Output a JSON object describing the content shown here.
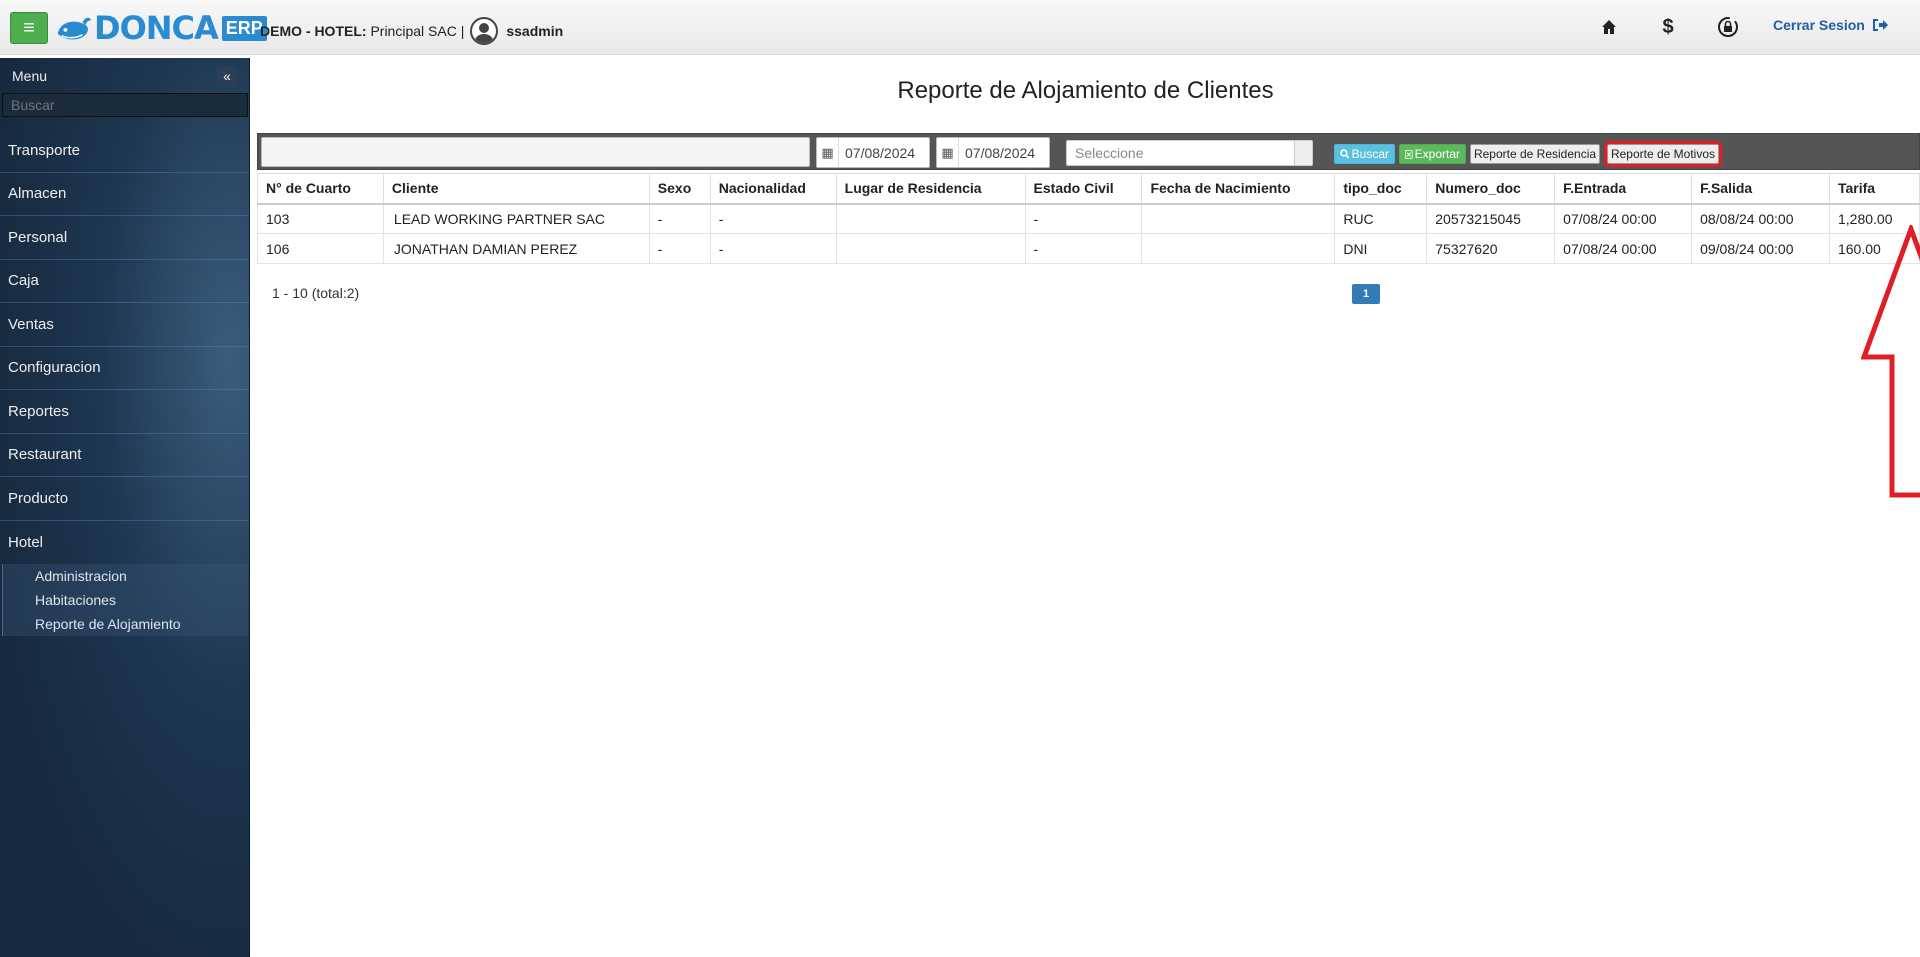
{
  "header": {
    "logo_text": "DONCA",
    "logo_badge": "ERP",
    "company_prefix": "DEMO - HOTEL:",
    "company_name": "Principal SAC |",
    "username": "ssadmin",
    "logout_label": "Cerrar Sesion",
    "icons": [
      "hamburger-icon",
      "home-icon",
      "dollar-icon",
      "lock-icon",
      "logout-icon"
    ]
  },
  "sidebar": {
    "title": "Menu",
    "search_placeholder": "Buscar",
    "items": [
      "Transporte",
      "Almacen",
      "Personal",
      "Caja",
      "Ventas",
      "Configuracion",
      "Reportes",
      "Restaurant",
      "Producto",
      "Hotel"
    ],
    "subitems": [
      "Administracion",
      "Habitaciones",
      "Reporte de Alojamiento"
    ]
  },
  "main": {
    "title": "Reporte de Alojamiento de Clientes",
    "date_from": "07/08/2024",
    "date_to": "07/08/2024",
    "select_placeholder": "Seleccione",
    "buttons": {
      "buscar": "Buscar",
      "exportar": "Exportar",
      "reporte_residencia": "Reporte de Residencia",
      "reporte_motivos": "Reporte de Motivos"
    },
    "table": {
      "columns": [
        "N° de Cuarto",
        "Cliente",
        "Sexo",
        "Nacionalidad",
        "Lugar de Residencia",
        "Estado Civil",
        "Fecha de Nacimiento",
        "tipo_doc",
        "Numero_doc",
        "F.Entrada",
        "F.Salida",
        "Tarifa"
      ],
      "rows": [
        [
          "103",
          "LEAD WORKING PARTNER SAC",
          "-",
          "-",
          "",
          "-",
          "",
          "RUC",
          "20573215045",
          "07/08/24 00:00",
          "08/08/24 00:00",
          "1,280.00"
        ],
        [
          "106",
          "JONATHAN DAMIAN PEREZ",
          "-",
          "-",
          "",
          "-",
          "",
          "DNI",
          "75327620",
          "07/08/24 00:00",
          "09/08/24 00:00",
          "160.00"
        ]
      ]
    },
    "pager_info": "1 - 10 (total:2)",
    "pager_page": "1"
  },
  "colors": {
    "accent_green": "#5cb85c",
    "accent_blue": "#2a8bd2",
    "highlight_red": "#e01e25",
    "sidebar_bg": "#1e3650"
  }
}
